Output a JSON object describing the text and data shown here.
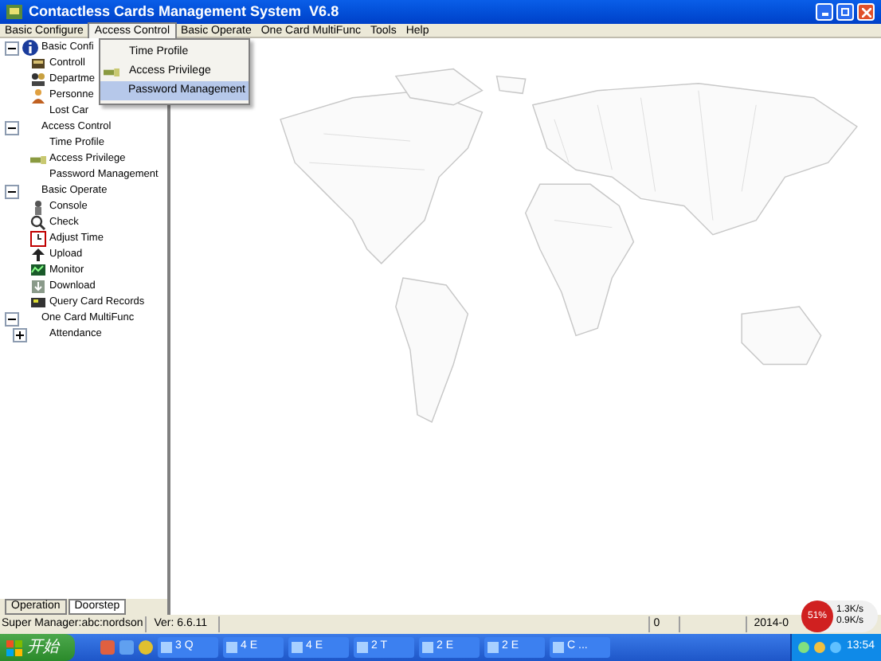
{
  "window": {
    "title": "Contactless Cards Management System  V6.8"
  },
  "menu": [
    {
      "label": "Basic Configure",
      "selected": false
    },
    {
      "label": "Access Control",
      "selected": true
    },
    {
      "label": "Basic Operate",
      "selected": false
    },
    {
      "label": "One Card MultiFunc",
      "selected": false
    },
    {
      "label": "Tools",
      "selected": false
    },
    {
      "label": "Help",
      "selected": false
    }
  ],
  "dropdown": [
    {
      "label": "Time Profile",
      "selected": false
    },
    {
      "label": "Access Privilege",
      "selected": false
    },
    {
      "label": "Password Management",
      "selected": true
    }
  ],
  "tree": [
    {
      "label": "Basic Confi",
      "expanded": true,
      "children": [
        {
          "label": "Controll"
        },
        {
          "label": "Departme"
        },
        {
          "label": "Personne"
        },
        {
          "label": "Lost Car"
        }
      ]
    },
    {
      "label": "Access Control",
      "expanded": true,
      "children": [
        {
          "label": "Time Profile"
        },
        {
          "label": "Access Privilege"
        },
        {
          "label": "Password Management"
        }
      ]
    },
    {
      "label": "Basic Operate",
      "expanded": true,
      "children": [
        {
          "label": "Console"
        },
        {
          "label": "Check"
        },
        {
          "label": "Adjust Time"
        },
        {
          "label": "Upload"
        },
        {
          "label": "Monitor"
        },
        {
          "label": "Download"
        },
        {
          "label": "Query Card Records"
        }
      ]
    },
    {
      "label": "One Card MultiFunc",
      "expanded": true,
      "children": [
        {
          "label": "Attendance",
          "expanded": false
        }
      ]
    }
  ],
  "bottom_tabs": [
    {
      "label": "Operation",
      "selected": false
    },
    {
      "label": "Doorstep",
      "selected": true
    }
  ],
  "status_bar": {
    "user": "Super Manager:abc:nordson",
    "version": "Ver: 6.6.11",
    "count": "0",
    "date": "2014-0"
  },
  "network_widget": {
    "percent": "51%",
    "up": "1.3K/s",
    "down": "0.9K/s"
  },
  "taskbar": {
    "start": "开始",
    "tasks": [
      "3 Q",
      "4 E",
      "4 E",
      "2 T",
      "2 E",
      "2 E",
      "C ..."
    ],
    "clock": "13:54"
  }
}
